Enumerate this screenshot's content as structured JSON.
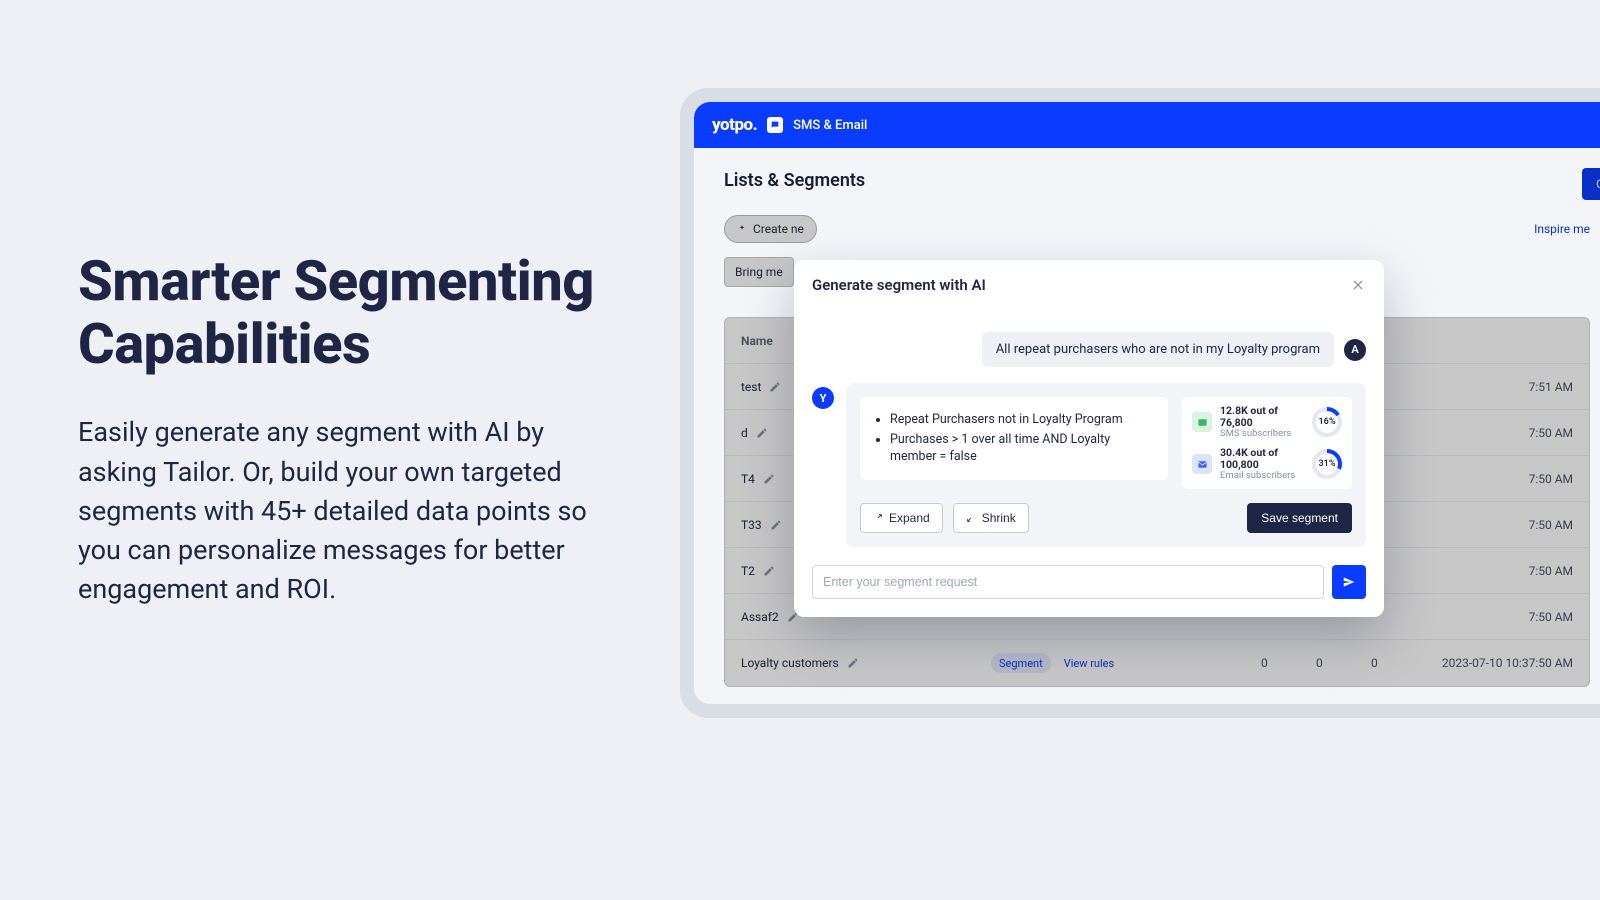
{
  "hero": {
    "title_l1": "Smarter Segmenting",
    "title_l2": "Capabilities",
    "body": "Easily generate any segment with AI by asking Tailor. Or, build your own targeted segments with 45+ detailed data points so you can personalize messages for better engagement and ROI."
  },
  "app": {
    "brand": "yotpo",
    "brand_dot": ".",
    "brand_sub": "SMS & Email",
    "page_title": "Lists & Segments",
    "create_new": "Create ne",
    "inspire": "Inspire me",
    "bring_chip": "Bring me",
    "top_button": "Cr"
  },
  "table": {
    "headers": {
      "name": "Name"
    },
    "rows": [
      {
        "name": "test",
        "time": "7:51 AM"
      },
      {
        "name": "d",
        "time": "7:50 AM"
      },
      {
        "name": "T4",
        "time": "7:50 AM"
      },
      {
        "name": "T33",
        "time": "7:50 AM"
      },
      {
        "name": "T2",
        "time": "7:50 AM"
      },
      {
        "name": "Assaf2",
        "time": "7:50 AM"
      },
      {
        "name": "Loyalty customers",
        "badge": "Segment",
        "link": "View rules",
        "c1": "0",
        "c2": "0",
        "c3": "0",
        "time": "2023-07-10 10:37:50 AM"
      }
    ]
  },
  "modal": {
    "title": "Generate segment with AI",
    "user_avatar": "A",
    "user_msg": "All repeat purchasers who are not in my Loyalty program",
    "bot_avatar": "Y",
    "bullets": [
      "Repeat Purchasers not in Loyalty Program",
      "Purchases > 1 over all time AND Loyalty member = false"
    ],
    "stats": {
      "sms": {
        "main": "12.8K out of 76,800",
        "sub": "SMS subscribers",
        "pct": "16%",
        "deg": 58
      },
      "email": {
        "main": "30.4K out of 100,800",
        "sub": "Email subscribers",
        "pct": "31%",
        "deg": 112
      }
    },
    "expand": "Expand",
    "shrink": "Shrink",
    "save": "Save segment",
    "placeholder": "Enter your segment request"
  },
  "colors": {
    "primary_blue": "#0a3cff",
    "navy": "#1f2544",
    "page_bg": "#eef0f5"
  }
}
